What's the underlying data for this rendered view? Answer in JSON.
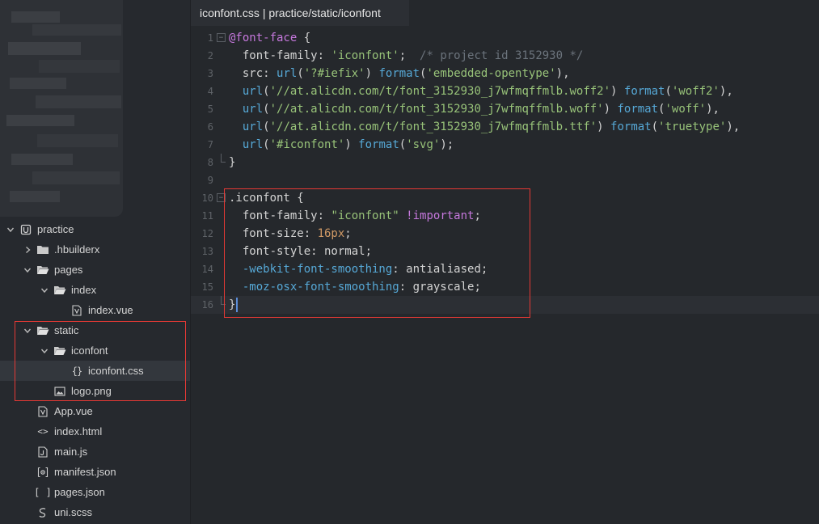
{
  "tab": {
    "title": "iconfont.css | practice/static/iconfont"
  },
  "tree": [
    {
      "label": "practice",
      "icon": "project-icon",
      "chevron": "down",
      "depth": 0
    },
    {
      "label": ".hbuilderx",
      "icon": "folder-icon",
      "chevron": "right",
      "depth": 1
    },
    {
      "label": "pages",
      "icon": "folder-open-icon",
      "chevron": "down",
      "depth": 1
    },
    {
      "label": "index",
      "icon": "folder-open-icon",
      "chevron": "down",
      "depth": 2
    },
    {
      "label": "index.vue",
      "icon": "vue-file-icon",
      "chevron": "none",
      "depth": 3
    },
    {
      "label": "static",
      "icon": "folder-open-icon",
      "chevron": "down",
      "depth": 1
    },
    {
      "label": "iconfont",
      "icon": "folder-open-icon",
      "chevron": "down",
      "depth": 2
    },
    {
      "label": "iconfont.css",
      "icon": "css-file-icon",
      "chevron": "none",
      "depth": 3,
      "selected": true
    },
    {
      "label": "logo.png",
      "icon": "image-file-icon",
      "chevron": "none",
      "depth": 2
    },
    {
      "label": "App.vue",
      "icon": "vue-file-icon",
      "chevron": "none",
      "depth": 1
    },
    {
      "label": "index.html",
      "icon": "html-file-icon",
      "chevron": "none",
      "depth": 1
    },
    {
      "label": "main.js",
      "icon": "js-file-icon",
      "chevron": "none",
      "depth": 1
    },
    {
      "label": "manifest.json",
      "icon": "manifest-file-icon",
      "chevron": "none",
      "depth": 1
    },
    {
      "label": "pages.json",
      "icon": "json-file-icon",
      "chevron": "none",
      "depth": 1
    },
    {
      "label": "uni.scss",
      "icon": "scss-file-icon",
      "chevron": "none",
      "depth": 1
    }
  ],
  "code": [
    {
      "n": "1",
      "fold": "start",
      "tokens": [
        [
          "at",
          "@font-face"
        ],
        [
          "kw",
          " {"
        ]
      ]
    },
    {
      "n": "2",
      "tokens": [
        [
          "kw",
          "  font-family: "
        ],
        [
          "str",
          "'iconfont'"
        ],
        [
          "kw",
          ";  "
        ],
        [
          "cm",
          "/* project id 3152930 */"
        ]
      ]
    },
    {
      "n": "3",
      "tokens": [
        [
          "kw",
          "  src: "
        ],
        [
          "fn",
          "url"
        ],
        [
          "kw",
          "("
        ],
        [
          "str",
          "'?#iefix'"
        ],
        [
          "kw",
          ") "
        ],
        [
          "fn",
          "format"
        ],
        [
          "kw",
          "("
        ],
        [
          "str",
          "'embedded-opentype'"
        ],
        [
          "kw",
          "),"
        ]
      ]
    },
    {
      "n": "4",
      "tokens": [
        [
          "kw",
          "  "
        ],
        [
          "fn",
          "url"
        ],
        [
          "kw",
          "("
        ],
        [
          "str",
          "'//at.alicdn.com/t/font_3152930_j7wfmqffmlb.woff2'"
        ],
        [
          "kw",
          ") "
        ],
        [
          "fn",
          "format"
        ],
        [
          "kw",
          "("
        ],
        [
          "str",
          "'woff2'"
        ],
        [
          "kw",
          "),"
        ]
      ]
    },
    {
      "n": "5",
      "tokens": [
        [
          "kw",
          "  "
        ],
        [
          "fn",
          "url"
        ],
        [
          "kw",
          "("
        ],
        [
          "str",
          "'//at.alicdn.com/t/font_3152930_j7wfmqffmlb.woff'"
        ],
        [
          "kw",
          ") "
        ],
        [
          "fn",
          "format"
        ],
        [
          "kw",
          "("
        ],
        [
          "str",
          "'woff'"
        ],
        [
          "kw",
          "),"
        ]
      ]
    },
    {
      "n": "6",
      "tokens": [
        [
          "kw",
          "  "
        ],
        [
          "fn",
          "url"
        ],
        [
          "kw",
          "("
        ],
        [
          "str",
          "'//at.alicdn.com/t/font_3152930_j7wfmqffmlb.ttf'"
        ],
        [
          "kw",
          ") "
        ],
        [
          "fn",
          "format"
        ],
        [
          "kw",
          "("
        ],
        [
          "str",
          "'truetype'"
        ],
        [
          "kw",
          "),"
        ]
      ]
    },
    {
      "n": "7",
      "tokens": [
        [
          "kw",
          "  "
        ],
        [
          "fn",
          "url"
        ],
        [
          "kw",
          "("
        ],
        [
          "str",
          "'#iconfont'"
        ],
        [
          "kw",
          ") "
        ],
        [
          "fn",
          "format"
        ],
        [
          "kw",
          "("
        ],
        [
          "str",
          "'svg'"
        ],
        [
          "kw",
          ");"
        ]
      ]
    },
    {
      "n": "8",
      "fold": "end",
      "tokens": [
        [
          "kw",
          "}"
        ]
      ]
    },
    {
      "n": "9",
      "tokens": []
    },
    {
      "n": "10",
      "fold": "start",
      "tokens": [
        [
          "sel",
          ".iconfont"
        ],
        [
          "kw",
          " {"
        ]
      ]
    },
    {
      "n": "11",
      "tokens": [
        [
          "kw",
          "  font-family: "
        ],
        [
          "str",
          "\"iconfont\""
        ],
        [
          "kw",
          " "
        ],
        [
          "imp",
          "!important"
        ],
        [
          "kw",
          ";"
        ]
      ]
    },
    {
      "n": "12",
      "tokens": [
        [
          "kw",
          "  font-size: "
        ],
        [
          "num",
          "16px"
        ],
        [
          "kw",
          ";"
        ]
      ]
    },
    {
      "n": "13",
      "tokens": [
        [
          "kw",
          "  font-style: normal;"
        ]
      ]
    },
    {
      "n": "14",
      "tokens": [
        [
          "kw",
          "  "
        ],
        [
          "vendor",
          "-webkit-font-smoothing"
        ],
        [
          "kw",
          ": antialiased;"
        ]
      ]
    },
    {
      "n": "15",
      "tokens": [
        [
          "kw",
          "  "
        ],
        [
          "vendor",
          "-moz-osx-font-smoothing"
        ],
        [
          "kw",
          ": grayscale;"
        ]
      ]
    },
    {
      "n": "16",
      "fold": "end",
      "current": true,
      "tokens": [
        [
          "kw",
          "}"
        ]
      ]
    }
  ]
}
